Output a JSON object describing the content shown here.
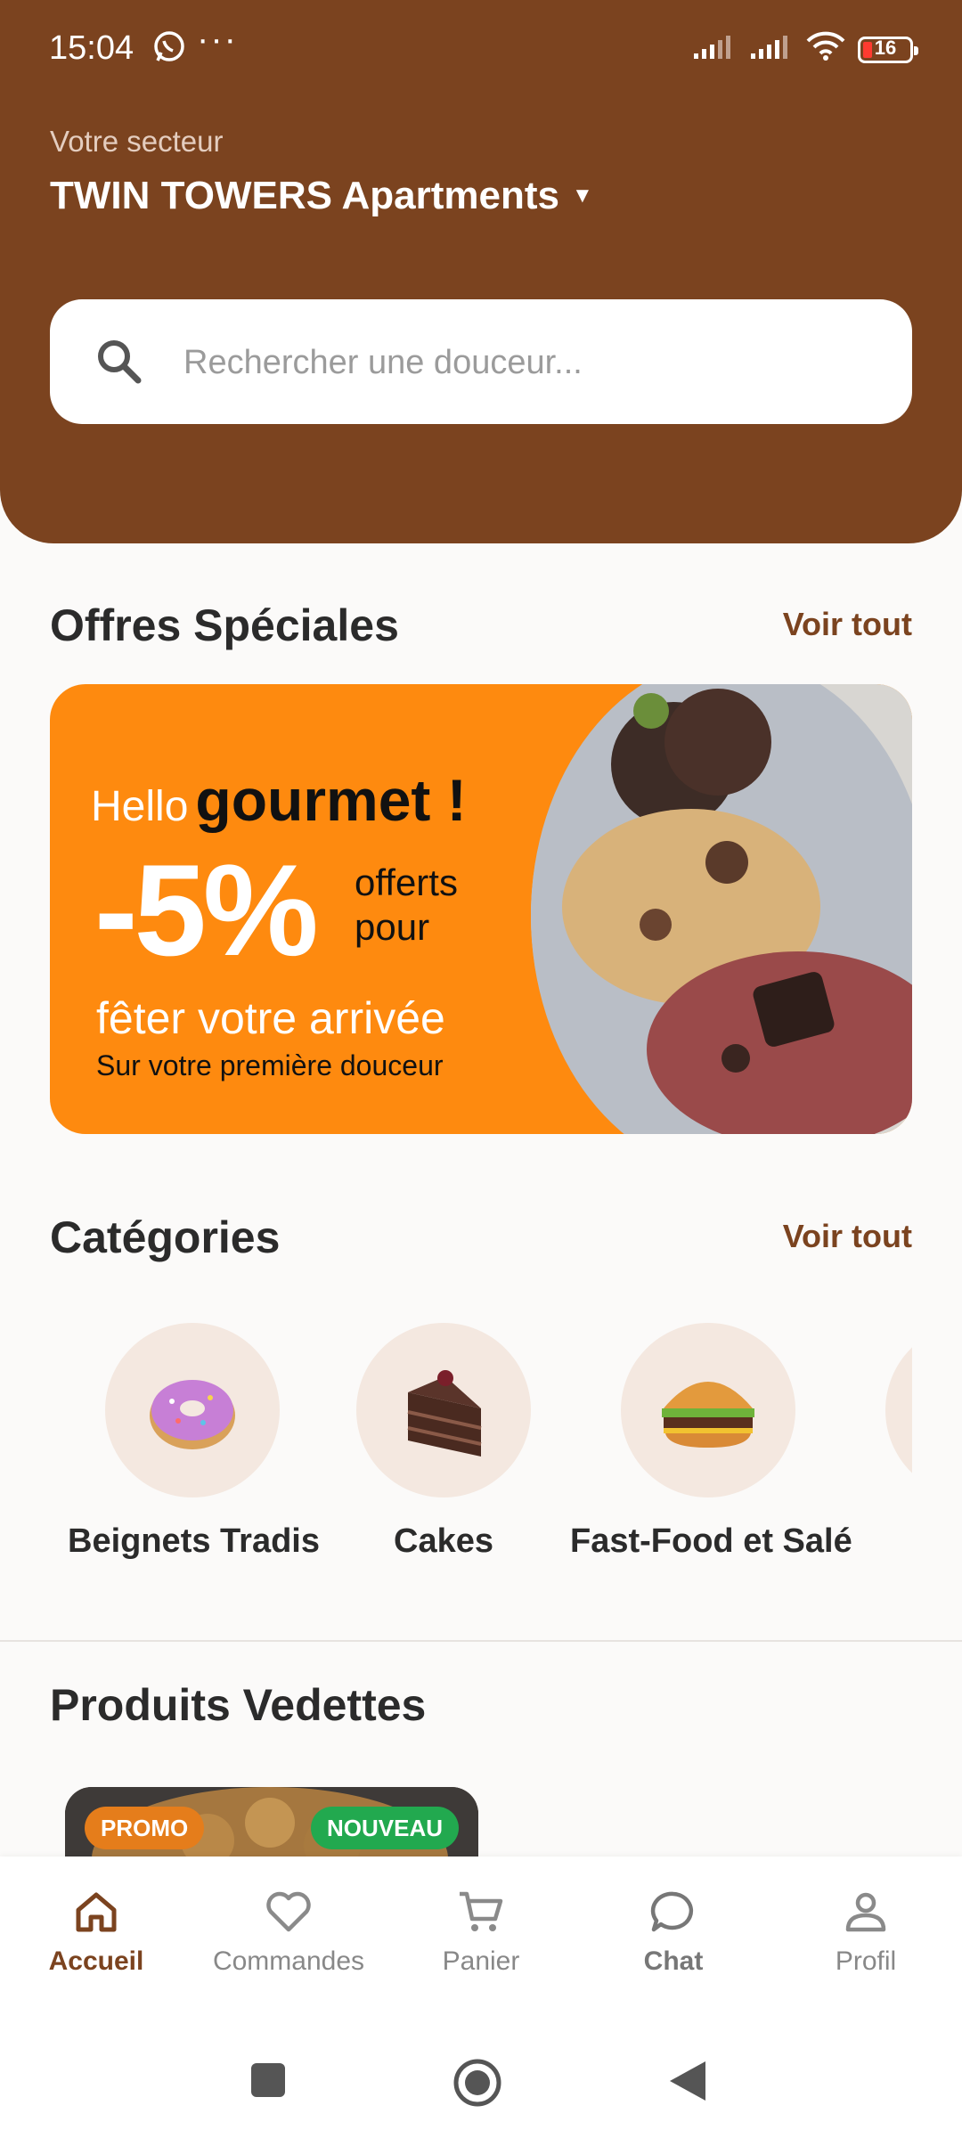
{
  "status_bar": {
    "time": "15:04",
    "more": "···",
    "battery": "16"
  },
  "header": {
    "sector_label": "Votre secteur",
    "sector_name": "TWIN TOWERS Apartments"
  },
  "search": {
    "placeholder": "Rechercher une douceur..."
  },
  "special_offers": {
    "title": "Offres Spéciales",
    "see_all": "Voir tout",
    "banner": {
      "hello": "Hello",
      "gourmet": "gourmet !",
      "discount": "-5%",
      "offerts": "offerts",
      "pour": "pour",
      "celebrate": "fêter votre arrivée",
      "subtitle": "Sur votre première douceur"
    }
  },
  "categories": {
    "title": "Catégories",
    "see_all": "Voir tout",
    "items": [
      {
        "label": "Beignets Tradis",
        "icon": "donut-icon"
      },
      {
        "label": "Cakes",
        "icon": "cake-icon"
      },
      {
        "label": "Fast-Food et Salé",
        "icon": "burger-icon"
      },
      {
        "label": "",
        "icon": "category-icon"
      }
    ]
  },
  "featured": {
    "title": "Produits Vedettes",
    "badges": {
      "promo": "PROMO",
      "new": "NOUVEAU"
    }
  },
  "bottom_nav": {
    "items": [
      {
        "label": "Accueil",
        "icon": "home-icon",
        "active": true
      },
      {
        "label": "Commandes",
        "icon": "heart-icon"
      },
      {
        "label": "Panier",
        "icon": "cart-icon"
      },
      {
        "label": "Chat",
        "icon": "chat-icon"
      },
      {
        "label": "Profil",
        "icon": "profile-icon"
      }
    ]
  },
  "colors": {
    "brand": "#7b431f",
    "banner": "#fe8a0f",
    "promo": "#e57d1b",
    "new": "#22a94f"
  }
}
